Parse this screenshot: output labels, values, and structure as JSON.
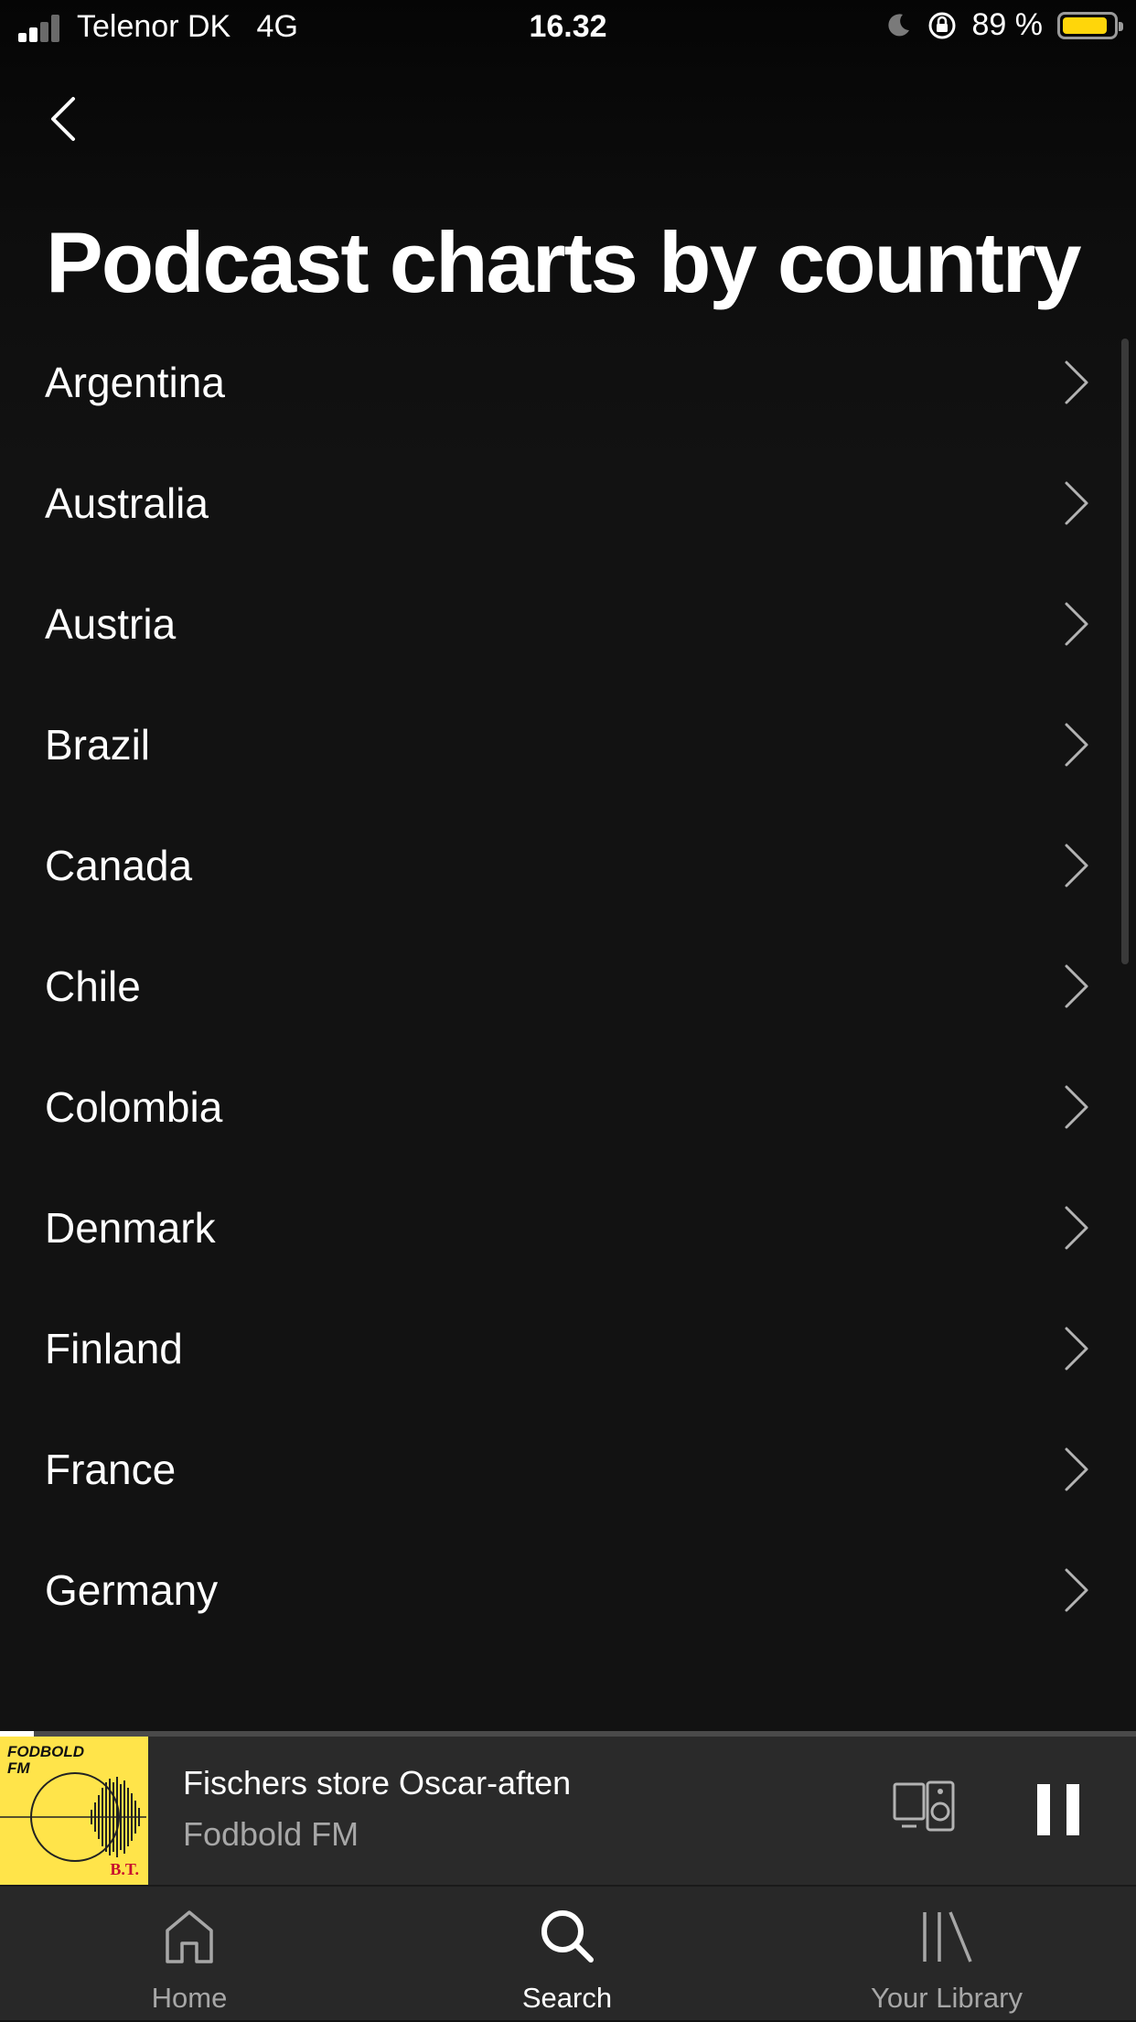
{
  "status_bar": {
    "carrier": "Telenor DK",
    "network": "4G",
    "time": "16.32",
    "battery": "89 %",
    "battery_level": 0.89
  },
  "header": {
    "title": "Podcast charts by country",
    "back_icon": "chevron-left-icon"
  },
  "countries": [
    {
      "label": "Argentina"
    },
    {
      "label": "Australia"
    },
    {
      "label": "Austria"
    },
    {
      "label": "Brazil"
    },
    {
      "label": "Canada"
    },
    {
      "label": "Chile"
    },
    {
      "label": "Colombia"
    },
    {
      "label": "Denmark"
    },
    {
      "label": "Finland"
    },
    {
      "label": "France"
    },
    {
      "label": "Germany"
    }
  ],
  "now_playing": {
    "title": "Fischers store Oscar-aften",
    "artist": "Fodbold FM",
    "cover_text_line1": "FODBOLD",
    "cover_text_line2": "FM",
    "cover_brand": "B.T.",
    "progress": 0.03
  },
  "tabs": [
    {
      "label": "Home",
      "icon": "home-icon",
      "active": false
    },
    {
      "label": "Search",
      "icon": "search-icon",
      "active": true
    },
    {
      "label": "Your Library",
      "icon": "library-icon",
      "active": false
    }
  ],
  "colors": {
    "background": "#121212",
    "player": "#2a2a2a",
    "tabbar": "#282828",
    "battery": "#ffd60a",
    "cover": "#ffe44a"
  }
}
